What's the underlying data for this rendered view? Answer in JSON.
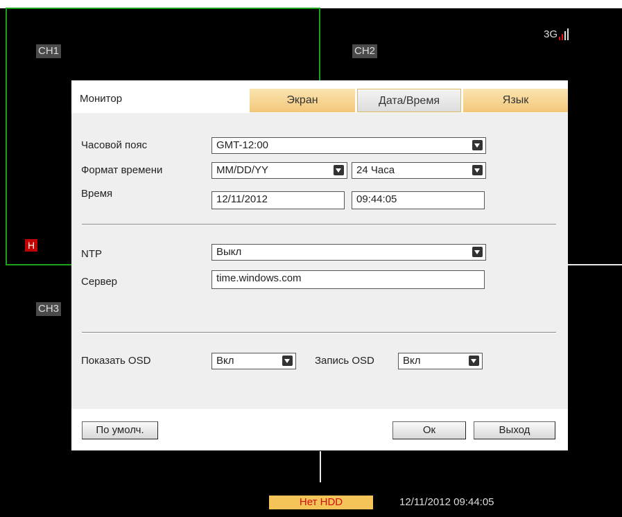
{
  "cameras": {
    "ch1": "CH1",
    "ch2": "CH2",
    "ch3": "CH3",
    "record_mark": "H",
    "signal": "3G"
  },
  "dialog": {
    "title": "Монитор",
    "tabs": [
      {
        "label": "Экран",
        "active": false
      },
      {
        "label": "Дата/Время",
        "active": true
      },
      {
        "label": "Язык",
        "active": false
      }
    ],
    "timezone": {
      "label": "Часовой пояс",
      "value": "GMT-12:00"
    },
    "time_format": {
      "label": "Формат времени",
      "date_value": "MM/DD/YY",
      "hour_value": "24 Часа"
    },
    "time": {
      "label": "Время",
      "date": "12/11/2012",
      "clock": "09:44:05"
    },
    "ntp": {
      "label": "NTP",
      "value": "Выкл"
    },
    "server": {
      "label": "Сервер",
      "value": "time.windows.com"
    },
    "show_osd": {
      "label": "Показать OSD",
      "value": "Вкл"
    },
    "record_osd": {
      "label": "Запись OSD",
      "value": "Вкл"
    },
    "buttons": {
      "default": "По умолч.",
      "ok": "Ок",
      "exit": "Выход"
    }
  },
  "status_bar": {
    "hdd": "Нет HDD",
    "datetime": "12/11/2012 09:44:05"
  },
  "colors": {
    "accent_tab": "#f2c77a",
    "record_red": "#c30000",
    "hdd_bg": "#f5c458",
    "selection_green": "#1aa31a"
  }
}
